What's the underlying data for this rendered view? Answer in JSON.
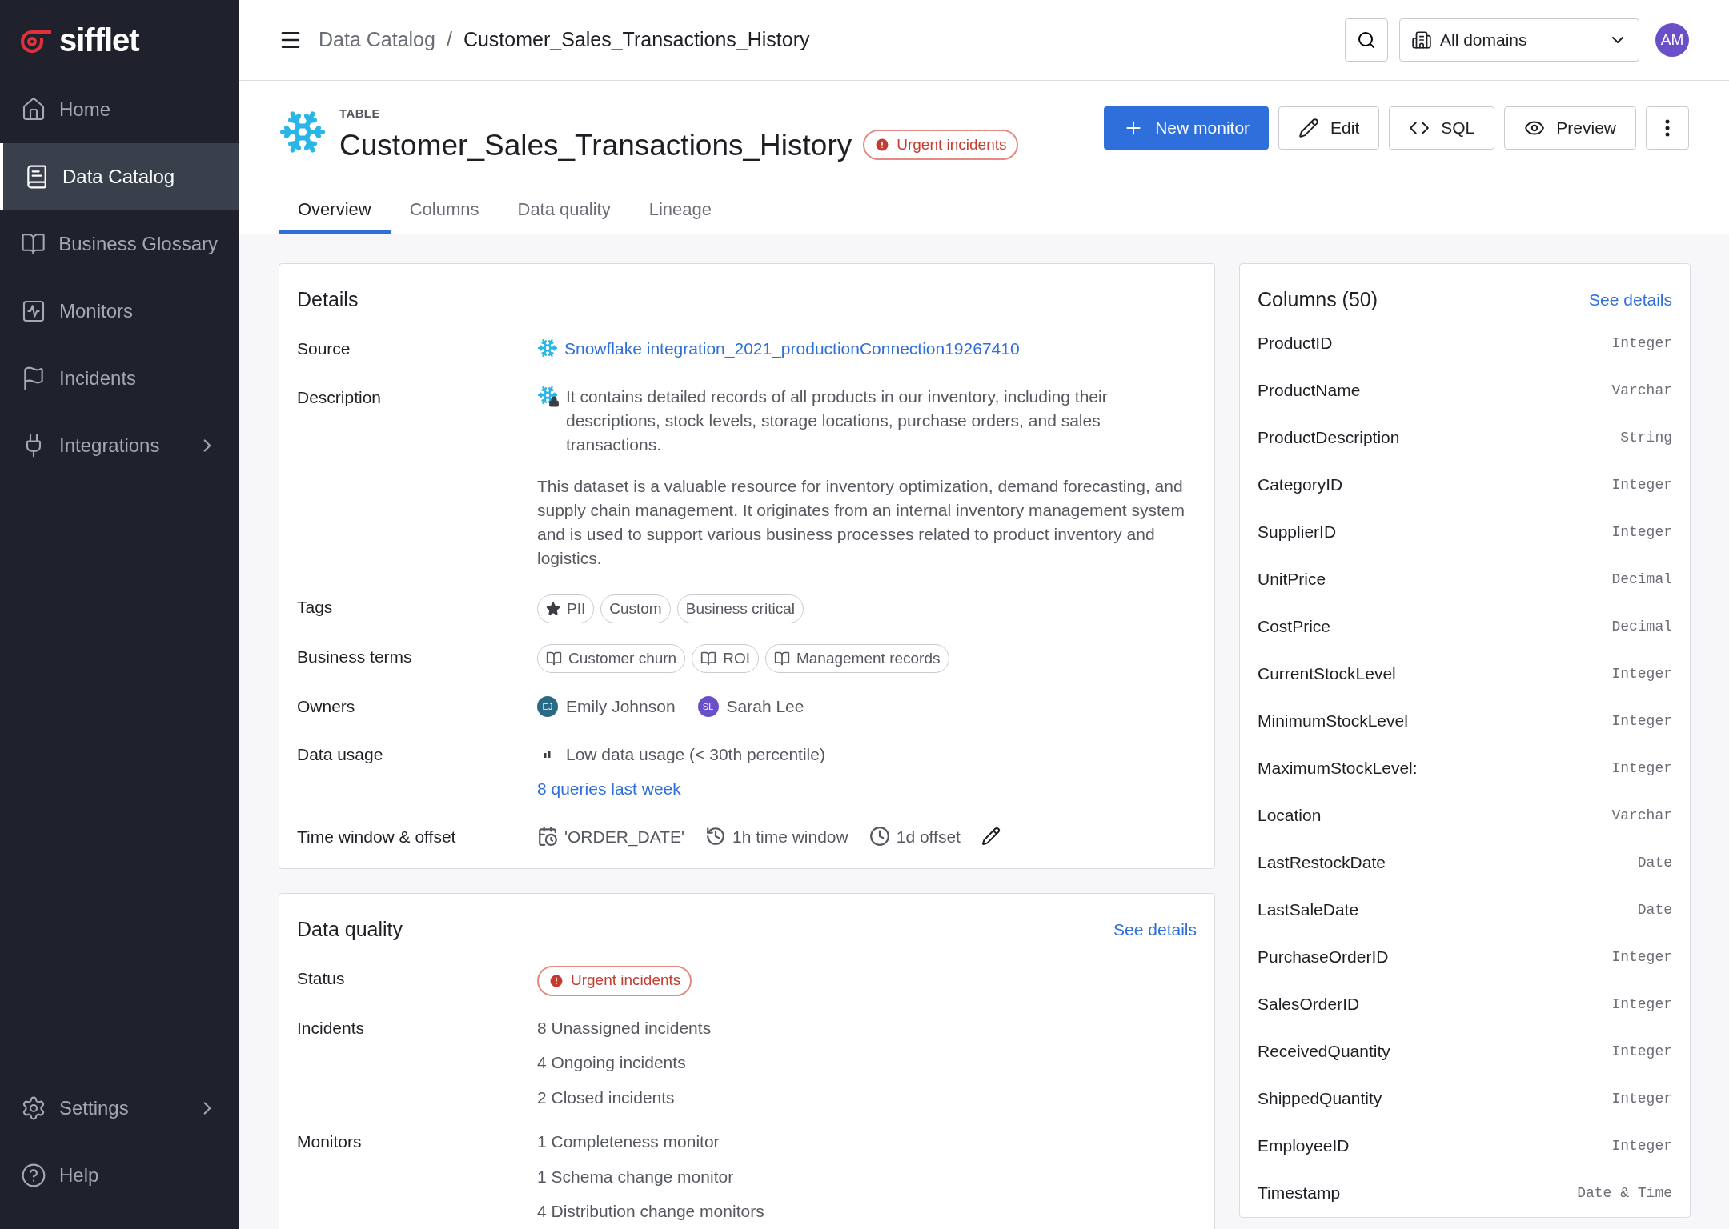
{
  "sidebar": {
    "logo": "sifflet",
    "items": [
      {
        "label": "Home",
        "selected": false,
        "submenu": false
      },
      {
        "label": "Data Catalog",
        "selected": true,
        "submenu": false
      },
      {
        "label": "Business Glossary",
        "selected": false,
        "submenu": false
      },
      {
        "label": "Monitors",
        "selected": false,
        "submenu": false
      },
      {
        "label": "Incidents",
        "selected": false,
        "submenu": false
      },
      {
        "label": "Integrations",
        "selected": false,
        "submenu": true
      }
    ],
    "bottom_items": [
      {
        "label": "Settings",
        "selected": false,
        "submenu": true
      },
      {
        "label": "Help",
        "selected": false,
        "submenu": false
      }
    ]
  },
  "header": {
    "separator": "/",
    "breadcrumb": [
      "Data Catalog",
      "Customer_Sales_Transactions_History"
    ],
    "domain": "All domains",
    "avatar": "AM"
  },
  "page": {
    "type_label": "TABLE",
    "title": "Customer_Sales_Transactions_History",
    "status_badge": "Urgent incidents",
    "actions": [
      {
        "label": "New monitor",
        "kind": "primary"
      },
      {
        "label": "Edit",
        "kind": "edit"
      },
      {
        "label": "SQL",
        "kind": "sql"
      },
      {
        "label": "Preview",
        "kind": "preview"
      }
    ],
    "tabs": [
      {
        "label": "Overview",
        "selected": true
      },
      {
        "label": "Columns",
        "selected": false
      },
      {
        "label": "Data quality",
        "selected": false
      },
      {
        "label": "Lineage",
        "selected": false
      }
    ]
  },
  "details": {
    "title": "Details",
    "rows": [
      {
        "label": "Source"
      },
      {
        "label": "Description"
      },
      {
        "label": "Tags"
      },
      {
        "label": "Business terms"
      },
      {
        "label": "Owners"
      },
      {
        "label": "Data usage"
      },
      {
        "label": "Time window & offset"
      }
    ],
    "source": "Snowflake integration_2021_productionConnection19267410",
    "description": [
      "It contains detailed records of all products in our inventory, including their descriptions, stock levels, storage locations, purchase orders, and sales transactions.",
      "This dataset is a valuable resource for inventory optimization, demand forecasting, and supply chain management. It originates from an internal inventory management system and is used to support various business processes related to product inventory and logistics."
    ],
    "tags": [
      {
        "label": "PII",
        "starred": true
      },
      {
        "label": "Custom",
        "starred": false
      },
      {
        "label": "Business critical",
        "starred": false
      }
    ],
    "business_terms": [
      "Customer churn",
      "ROI",
      "Management records"
    ],
    "owners": [
      {
        "initials": "EJ",
        "name": "Emily Johnson",
        "color": "#2b6a86"
      },
      {
        "initials": "SL",
        "name": "Sarah Lee",
        "color": "#6a4fc8"
      }
    ],
    "data_usage": {
      "text": "Low data usage (< 30th percentile)",
      "link": "8 queries last week"
    },
    "time_window": {
      "column": "'ORDER_DATE'",
      "window": "1h time window",
      "offset": "1d offset"
    }
  },
  "data_quality": {
    "title": "Data quality",
    "see_details": "See details",
    "rows": [
      {
        "label": "Status"
      },
      {
        "label": "Incidents"
      },
      {
        "label": "Monitors"
      }
    ],
    "status": "Urgent incidents",
    "incidents": [
      "8 Unassigned incidents",
      "4 Ongoing incidents",
      "2 Closed incidents"
    ],
    "monitors": [
      "1 Completeness monitor",
      "1 Schema change monitor",
      "4 Distribution change monitors"
    ]
  },
  "columns_panel": {
    "title": "Columns (50)",
    "see_details": "See details",
    "columns": [
      {
        "name": "ProductID",
        "type": "Integer"
      },
      {
        "name": "ProductName",
        "type": "Varchar"
      },
      {
        "name": "ProductDescription",
        "type": "String"
      },
      {
        "name": "CategoryID",
        "type": "Integer"
      },
      {
        "name": "SupplierID",
        "type": "Integer"
      },
      {
        "name": "UnitPrice",
        "type": "Decimal"
      },
      {
        "name": "CostPrice",
        "type": "Decimal"
      },
      {
        "name": "CurrentStockLevel",
        "type": "Integer"
      },
      {
        "name": "MinimumStockLevel",
        "type": "Integer"
      },
      {
        "name": "MaximumStockLevel:",
        "type": "Integer"
      },
      {
        "name": "Location",
        "type": "Varchar"
      },
      {
        "name": "LastRestockDate",
        "type": "Date"
      },
      {
        "name": "LastSaleDate",
        "type": "Date"
      },
      {
        "name": "PurchaseOrderID",
        "type": "Integer"
      },
      {
        "name": "SalesOrderID",
        "type": "Integer"
      },
      {
        "name": "ReceivedQuantity",
        "type": "Integer"
      },
      {
        "name": "ShippedQuantity",
        "type": "Integer"
      },
      {
        "name": "EmployeeID",
        "type": "Integer"
      },
      {
        "name": "Timestamp",
        "type": "Date & Time"
      }
    ]
  }
}
